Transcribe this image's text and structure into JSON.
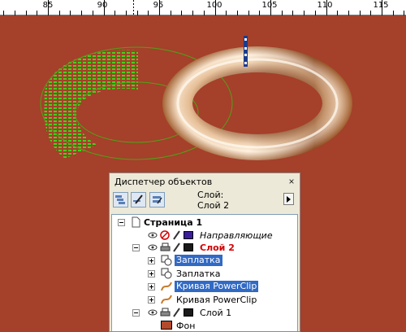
{
  "ruler": {
    "labels": [
      "85",
      "90",
      "95",
      "100",
      "105",
      "110",
      "115"
    ]
  },
  "docker": {
    "title": "Диспетчер объектов",
    "layer_label_line1": "Слой:",
    "layer_label_line2": "Слой 2"
  },
  "tree": {
    "page": "Страница 1",
    "guides": "Направляющие",
    "layer2": "Слой 2",
    "patch1": "Заплатка",
    "patch2": "Заплатка",
    "powerclip1": "Кривая PowerClip",
    "powerclip2": "Кривая PowerClip",
    "layer1": "Слой 1",
    "background": "Фон"
  },
  "colors": {
    "canvas": "#a5402a",
    "selection": "#316ac5",
    "layer2_name": "#d40000",
    "guides_swatch": "#3a1e9a",
    "background_swatch": "#b44a2c"
  }
}
